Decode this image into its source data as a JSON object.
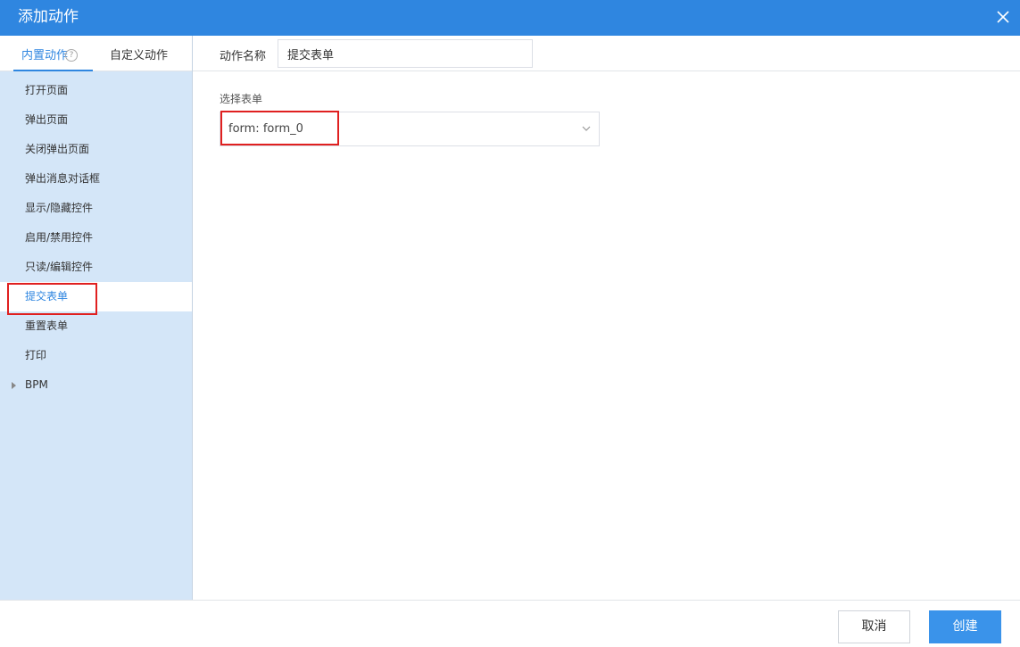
{
  "dialog": {
    "title": "添加动作"
  },
  "sidebar": {
    "tabs": [
      {
        "label": "内置动作"
      },
      {
        "label": "自定义动作"
      }
    ],
    "help_glyph": "?",
    "items": [
      {
        "label": "打开页面"
      },
      {
        "label": "弹出页面"
      },
      {
        "label": "关闭弹出页面"
      },
      {
        "label": "弹出消息对话框"
      },
      {
        "label": "显示/隐藏控件"
      },
      {
        "label": "启用/禁用控件"
      },
      {
        "label": "只读/编辑控件"
      },
      {
        "label": "提交表单"
      },
      {
        "label": "重置表单"
      },
      {
        "label": "打印"
      },
      {
        "label": "BPM"
      }
    ],
    "active_index": 7
  },
  "main": {
    "name_label": "动作名称",
    "name_value": "提交表单",
    "select_label": "选择表单",
    "select_value": "form: form_0"
  },
  "footer": {
    "cancel_label": "取消",
    "create_label": "创建"
  },
  "colors": {
    "accent": "#2f86e0",
    "sidebar_bg": "#d4e6f8",
    "highlight": "#e02020"
  }
}
